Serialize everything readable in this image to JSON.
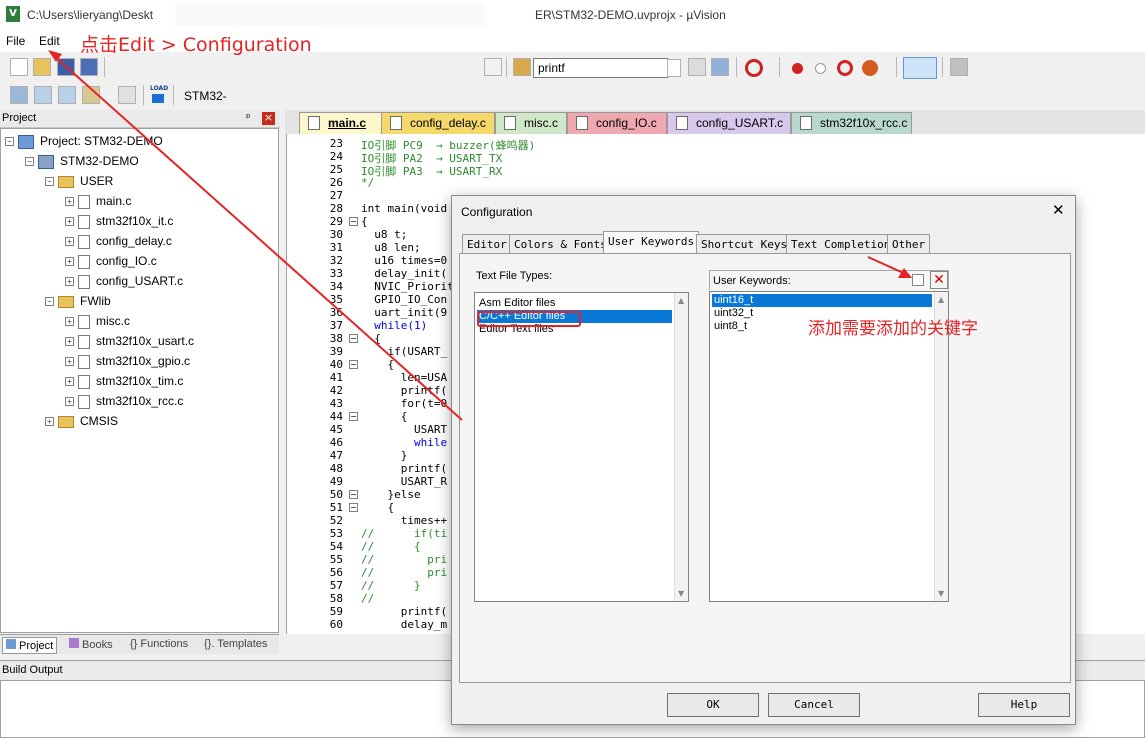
{
  "window": {
    "title": "C:\\Users\\lieryang\\Deskt",
    "title_tail": "ER\\STM32-DEMO.uvprojx - µVision",
    "app_icon": "V"
  },
  "menu": {
    "file": "File",
    "edit": "Edit"
  },
  "toolbar": {
    "find_text": "printf",
    "target": "STM32-",
    "load_label": "LOAD"
  },
  "project_panel": {
    "title": "Project",
    "pin": "ᵖ",
    "close": "×",
    "tree": {
      "root": "Project: STM32-DEMO",
      "target": "STM32-DEMO",
      "groups": [
        {
          "name": "USER",
          "files": [
            "main.c",
            "stm32f10x_it.c",
            "config_delay.c",
            "config_IO.c",
            "config_USART.c"
          ]
        },
        {
          "name": "FWlib",
          "files": [
            "misc.c",
            "stm32f10x_usart.c",
            "stm32f10x_gpio.c",
            "stm32f10x_tim.c",
            "stm32f10x_rcc.c"
          ]
        },
        {
          "name": "CMSIS",
          "files": []
        }
      ]
    },
    "bottom_tabs": [
      "Project",
      "Books",
      "{} Functions",
      "{}. Templates"
    ]
  },
  "editor_tabs": [
    {
      "label": "main.c",
      "color": "#fff7cc"
    },
    {
      "label": "config_delay.c",
      "color": "#f5d96a"
    },
    {
      "label": "misc.c",
      "color": "#cfe8c8"
    },
    {
      "label": "config_IO.c",
      "color": "#f0a8b0"
    },
    {
      "label": "config_USART.c",
      "color": "#d7c8ec"
    },
    {
      "label": "stm32f10x_rcc.c",
      "color": "#b8d8cf"
    }
  ],
  "editor": {
    "lines": [
      {
        "n": "23",
        "fold": "",
        "text": "IO引脚 PC9  → buzzer(蜂鸣器)",
        "cls": "cm"
      },
      {
        "n": "24",
        "fold": "",
        "text": "IO引脚 PA2  → USART_TX",
        "cls": "cm"
      },
      {
        "n": "25",
        "fold": "",
        "text": "IO引脚 PA3  → USART_RX",
        "cls": "cm"
      },
      {
        "n": "26",
        "fold": "",
        "text": "*/",
        "cls": "cm"
      },
      {
        "n": "27",
        "fold": "",
        "text": "",
        "cls": ""
      },
      {
        "n": "28",
        "fold": "",
        "text": "int main(void",
        "cls": ""
      },
      {
        "n": "29",
        "fold": "-",
        "text": "{",
        "cls": ""
      },
      {
        "n": "30",
        "fold": "",
        "text": "  u8 t;",
        "cls": ""
      },
      {
        "n": "31",
        "fold": "",
        "text": "  u8 len;",
        "cls": ""
      },
      {
        "n": "32",
        "fold": "",
        "text": "  u16 times=0",
        "cls": ""
      },
      {
        "n": "33",
        "fold": "",
        "text": "  delay_init(",
        "cls": ""
      },
      {
        "n": "34",
        "fold": "",
        "text": "  NVIC_Priorit",
        "cls": ""
      },
      {
        "n": "35",
        "fold": "",
        "text": "  GPIO_IO_Con",
        "cls": ""
      },
      {
        "n": "36",
        "fold": "",
        "text": "  uart_init(9",
        "cls": ""
      },
      {
        "n": "37",
        "fold": "",
        "text": "  while(1)",
        "cls": "kw"
      },
      {
        "n": "38",
        "fold": "-",
        "text": "  {",
        "cls": ""
      },
      {
        "n": "39",
        "fold": "",
        "text": "    if(USART_",
        "cls": ""
      },
      {
        "n": "40",
        "fold": "-",
        "text": "    {",
        "cls": ""
      },
      {
        "n": "41",
        "fold": "",
        "text": "      len=USA",
        "cls": ""
      },
      {
        "n": "42",
        "fold": "",
        "text": "      printf(",
        "cls": ""
      },
      {
        "n": "43",
        "fold": "",
        "text": "      for(t=0",
        "cls": ""
      },
      {
        "n": "44",
        "fold": "-",
        "text": "      {",
        "cls": ""
      },
      {
        "n": "45",
        "fold": "",
        "text": "        USART",
        "cls": ""
      },
      {
        "n": "46",
        "fold": "",
        "text": "        while",
        "cls": "kw"
      },
      {
        "n": "47",
        "fold": "",
        "text": "      }",
        "cls": ""
      },
      {
        "n": "48",
        "fold": "",
        "text": "      printf(",
        "cls": ""
      },
      {
        "n": "49",
        "fold": "",
        "text": "      USART_R",
        "cls": ""
      },
      {
        "n": "50",
        "fold": "-",
        "text": "    }else",
        "cls": ""
      },
      {
        "n": "51",
        "fold": "-",
        "text": "    {",
        "cls": ""
      },
      {
        "n": "52",
        "fold": "",
        "text": "      times++",
        "cls": ""
      },
      {
        "n": "53",
        "fold": "",
        "text": "//      if(ti",
        "cls": "cm"
      },
      {
        "n": "54",
        "fold": "",
        "text": "//      {",
        "cls": "cm"
      },
      {
        "n": "55",
        "fold": "",
        "text": "//        pri",
        "cls": "cm"
      },
      {
        "n": "56",
        "fold": "",
        "text": "//        pri",
        "cls": "cm"
      },
      {
        "n": "57",
        "fold": "",
        "text": "//      }",
        "cls": "cm"
      },
      {
        "n": "58",
        "fold": "",
        "text": "//",
        "cls": "cm"
      },
      {
        "n": "59",
        "fold": "",
        "text": "      printf(",
        "cls": ""
      },
      {
        "n": "60",
        "fold": "",
        "text": "      delay_m",
        "cls": ""
      }
    ]
  },
  "build_output": {
    "title": "Build Output"
  },
  "dialog": {
    "title": "Configuration",
    "close": "✕",
    "tabs": [
      "Editor",
      "Colors & Fonts",
      "User Keywords",
      "Shortcut Keys",
      "Text Completion",
      "Other"
    ],
    "active_tab": "User Keywords",
    "file_types_label": "Text File Types:",
    "file_types": [
      "Asm Editor files",
      "C/C++ Editor files",
      "Editor Text files"
    ],
    "selected_file_type": "C/C++ Editor files",
    "keywords_label": "User Keywords:",
    "keywords": [
      "uint16_t",
      "uint32_t",
      "uint8_t"
    ],
    "selected_keyword": "uint16_t",
    "buttons": {
      "ok": "OK",
      "cancel": "Cancel",
      "help": "Help"
    }
  },
  "annotations": {
    "step1": "点击Edit > Configuration",
    "step2": "添加需要添加的关键字",
    "color": "#e52323"
  }
}
